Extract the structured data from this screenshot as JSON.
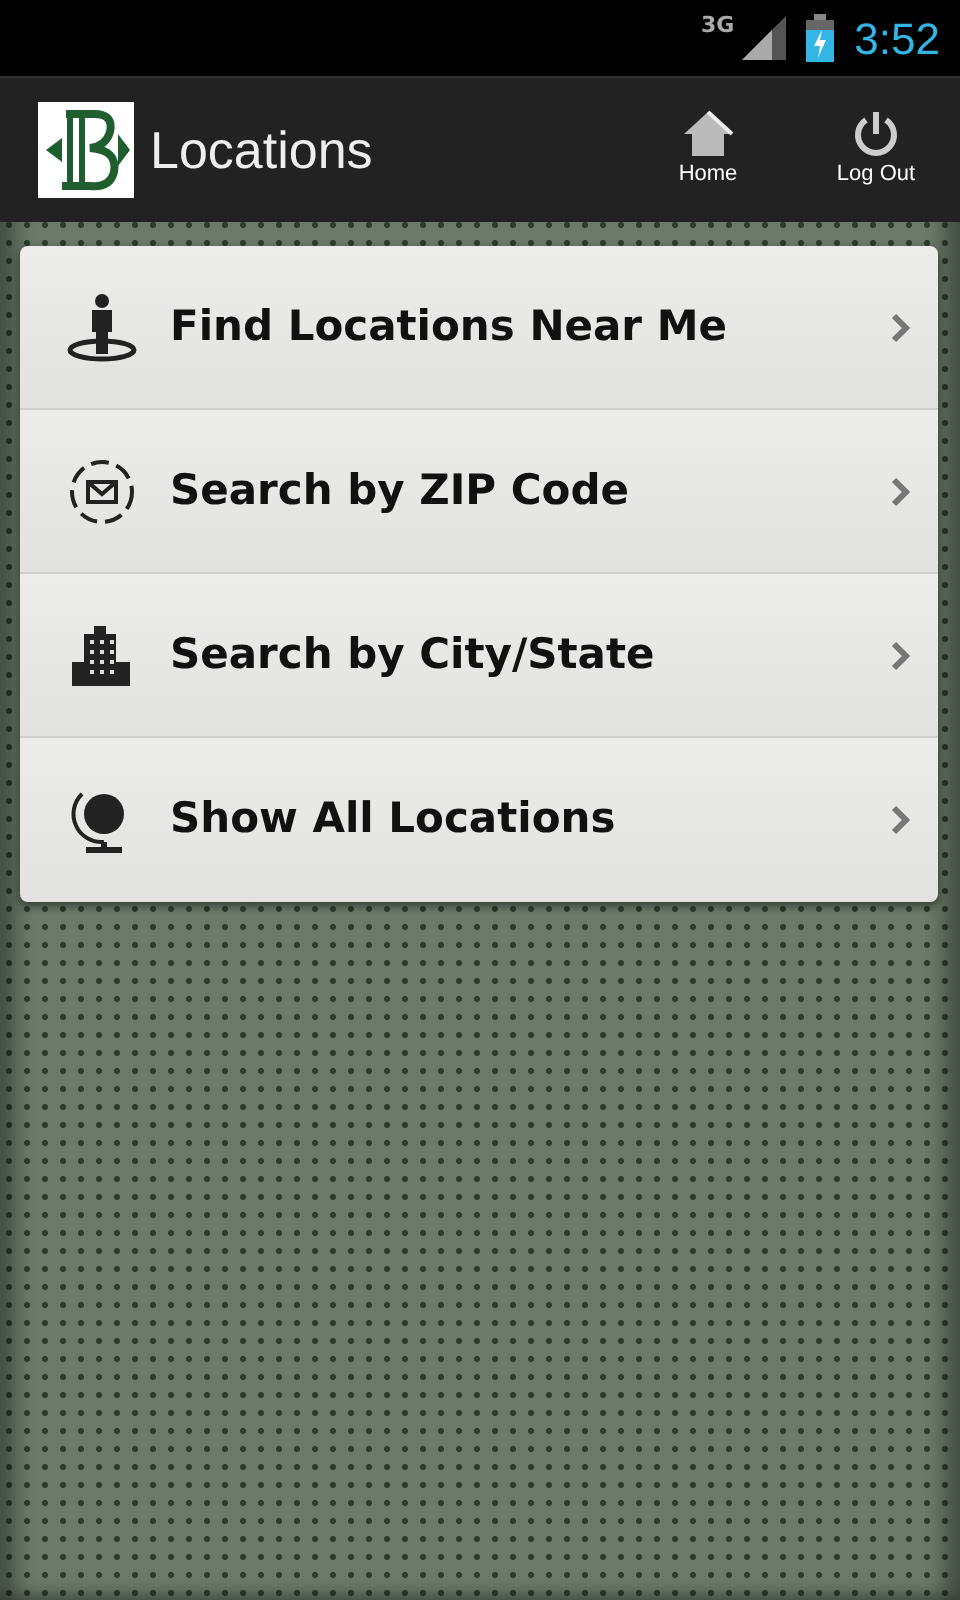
{
  "status_bar": {
    "network": "3G",
    "time": "3:52"
  },
  "app_bar": {
    "title": "Locations",
    "actions": [
      {
        "kind": "home",
        "label": "Home"
      },
      {
        "kind": "power",
        "label": "Log Out"
      }
    ]
  },
  "menu": [
    {
      "kind": "person",
      "label": "Find Locations Near Me"
    },
    {
      "kind": "mail",
      "label": "Search by ZIP Code"
    },
    {
      "kind": "building",
      "label": "Search by City/State"
    },
    {
      "kind": "globe",
      "label": "Show All Locations"
    }
  ]
}
